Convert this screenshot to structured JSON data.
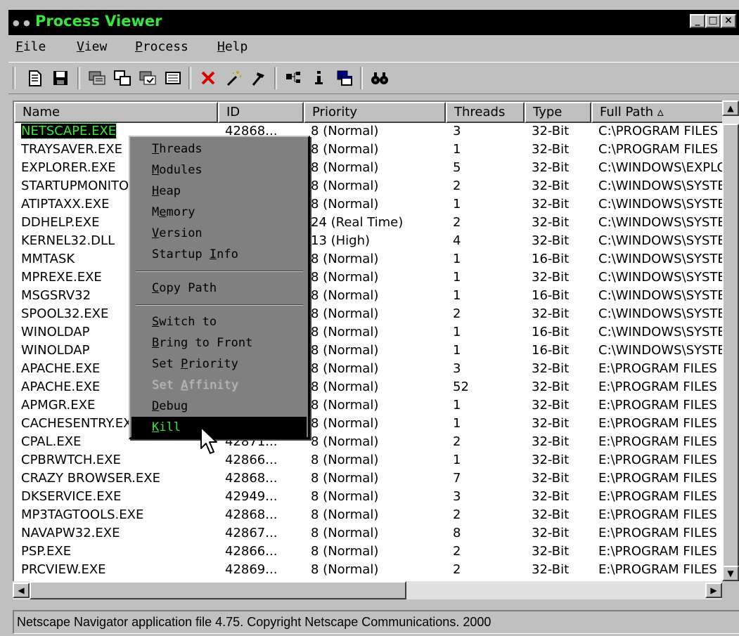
{
  "window": {
    "title": "Process Viewer",
    "controls": {
      "minimize": "_",
      "maximize": "□",
      "close": "×"
    }
  },
  "menubar": {
    "items": [
      {
        "label": "File"
      },
      {
        "label": "View"
      },
      {
        "label": "Process"
      },
      {
        "label": "Help"
      }
    ]
  },
  "toolbar": {
    "icons": [
      "new-file-icon",
      "save-icon",
      "refresh-icon",
      "window-icon",
      "properties-icon",
      "list-icon",
      "kill-icon",
      "magic-wand-icon",
      "hammer-icon",
      "tree-icon",
      "info-icon",
      "windows-icon",
      "find-icon"
    ]
  },
  "columns": [
    {
      "label": "Name"
    },
    {
      "label": "ID"
    },
    {
      "label": "Priority"
    },
    {
      "label": "Threads"
    },
    {
      "label": "Type"
    },
    {
      "label": "Full Path  ▵"
    }
  ],
  "rows": [
    {
      "name": "NETSCAPE.EXE",
      "id": "42868...",
      "priority": "8  (Normal)",
      "threads": "3",
      "type": "32-Bit",
      "path": "C:\\PROGRAM FILES"
    },
    {
      "name": "TRAYSAVER.EXE",
      "id": "",
      "priority": "8  (Normal)",
      "threads": "1",
      "type": "32-Bit",
      "path": "C:\\PROGRAM FILES"
    },
    {
      "name": "EXPLORER.EXE",
      "id": "",
      "priority": "8  (Normal)",
      "threads": "5",
      "type": "32-Bit",
      "path": "C:\\WINDOWS\\EXPLORER"
    },
    {
      "name": "STARTUPMONITOR.EXE",
      "id": "",
      "priority": "8  (Normal)",
      "threads": "2",
      "type": "32-Bit",
      "path": "C:\\WINDOWS\\SYSTEM"
    },
    {
      "name": "ATIPTAXX.EXE",
      "id": "",
      "priority": "8  (Normal)",
      "threads": "1",
      "type": "32-Bit",
      "path": "C:\\WINDOWS\\SYSTEM"
    },
    {
      "name": "DDHELP.EXE",
      "id": "",
      "priority": "24  (Real Time)",
      "threads": "2",
      "type": "32-Bit",
      "path": "C:\\WINDOWS\\SYSTEM"
    },
    {
      "name": "KERNEL32.DLL",
      "id": "",
      "priority": "13  (High)",
      "threads": "4",
      "type": "32-Bit",
      "path": "C:\\WINDOWS\\SYSTEM"
    },
    {
      "name": "MMTASK",
      "id": "",
      "priority": "8  (Normal)",
      "threads": "1",
      "type": "16-Bit",
      "path": "C:\\WINDOWS\\SYSTEM"
    },
    {
      "name": "MPREXE.EXE",
      "id": "",
      "priority": "8  (Normal)",
      "threads": "1",
      "type": "32-Bit",
      "path": "C:\\WINDOWS\\SYSTEM"
    },
    {
      "name": "MSGSRV32",
      "id": "",
      "priority": "8  (Normal)",
      "threads": "1",
      "type": "16-Bit",
      "path": "C:\\WINDOWS\\SYSTEM"
    },
    {
      "name": "SPOOL32.EXE",
      "id": "",
      "priority": "8  (Normal)",
      "threads": "2",
      "type": "32-Bit",
      "path": "C:\\WINDOWS\\SYSTEM"
    },
    {
      "name": "WINOLDAP",
      "id": "",
      "priority": "8  (Normal)",
      "threads": "1",
      "type": "16-Bit",
      "path": "C:\\WINDOWS\\SYSTEM"
    },
    {
      "name": "WINOLDAP",
      "id": "",
      "priority": "8  (Normal)",
      "threads": "1",
      "type": "16-Bit",
      "path": "C:\\WINDOWS\\SYSTEM"
    },
    {
      "name": "APACHE.EXE",
      "id": "",
      "priority": "8  (Normal)",
      "threads": "3",
      "type": "32-Bit",
      "path": "E:\\PROGRAM FILES"
    },
    {
      "name": "APACHE.EXE",
      "id": "",
      "priority": "8  (Normal)",
      "threads": "52",
      "type": "32-Bit",
      "path": "E:\\PROGRAM FILES"
    },
    {
      "name": "APMGR.EXE",
      "id": "",
      "priority": "8  (Normal)",
      "threads": "1",
      "type": "32-Bit",
      "path": "E:\\PROGRAM FILES"
    },
    {
      "name": "CACHESENTRY.EXE",
      "id": "",
      "priority": "8  (Normal)",
      "threads": "1",
      "type": "32-Bit",
      "path": "E:\\PROGRAM FILES"
    },
    {
      "name": "CPAL.EXE",
      "id": "42871...",
      "priority": "8  (Normal)",
      "threads": "2",
      "type": "32-Bit",
      "path": "E:\\PROGRAM FILES"
    },
    {
      "name": "CPBRWTCH.EXE",
      "id": "42866...",
      "priority": "8  (Normal)",
      "threads": "1",
      "type": "32-Bit",
      "path": "E:\\PROGRAM FILES"
    },
    {
      "name": "CRAZY BROWSER.EXE",
      "id": "42868...",
      "priority": "8  (Normal)",
      "threads": "7",
      "type": "32-Bit",
      "path": "E:\\PROGRAM FILES"
    },
    {
      "name": "DKSERVICE.EXE",
      "id": "42949...",
      "priority": "8  (Normal)",
      "threads": "3",
      "type": "32-Bit",
      "path": "E:\\PROGRAM FILES"
    },
    {
      "name": "MP3TAGTOOLS.EXE",
      "id": "42868...",
      "priority": "8  (Normal)",
      "threads": "2",
      "type": "32-Bit",
      "path": "E:\\PROGRAM FILES"
    },
    {
      "name": "NAVAPW32.EXE",
      "id": "42867...",
      "priority": "8  (Normal)",
      "threads": "8",
      "type": "32-Bit",
      "path": "E:\\PROGRAM FILES"
    },
    {
      "name": "PSP.EXE",
      "id": "42866...",
      "priority": "8  (Normal)",
      "threads": "2",
      "type": "32-Bit",
      "path": "E:\\PROGRAM FILES"
    },
    {
      "name": "PRCVIEW.EXE",
      "id": "42869...",
      "priority": "8  (Normal)",
      "threads": "2",
      "type": "32-Bit",
      "path": "E:\\PROGRAM FILES"
    }
  ],
  "context_menu": {
    "groups": [
      [
        {
          "label": "Threads",
          "u": 0
        },
        {
          "label": "Modules",
          "u": 0
        },
        {
          "label": "Heap",
          "u": 0
        },
        {
          "label": "Memory",
          "u": 1
        },
        {
          "label": "Version",
          "u": 0
        },
        {
          "label": "Startup Info",
          "u": 8
        }
      ],
      [
        {
          "label": "Copy Path",
          "u": 0
        }
      ],
      [
        {
          "label": "Switch to",
          "u": 0
        },
        {
          "label": "Bring to Front",
          "u": 0
        },
        {
          "label": "Set Priority",
          "u": 4
        },
        {
          "label": "Set Affinity",
          "u": 4,
          "disabled": true
        },
        {
          "label": "Debug",
          "u": 0
        },
        {
          "label": "Kill",
          "u": 0,
          "highlighted": true
        }
      ]
    ]
  },
  "status": {
    "text": "Netscape Navigator application file 4.75.  Copyright Netscape Communications. 2000"
  },
  "colors": {
    "accent_green": "#39e63a",
    "highlight_bg": "#000000",
    "face": "#c0c0c0"
  }
}
